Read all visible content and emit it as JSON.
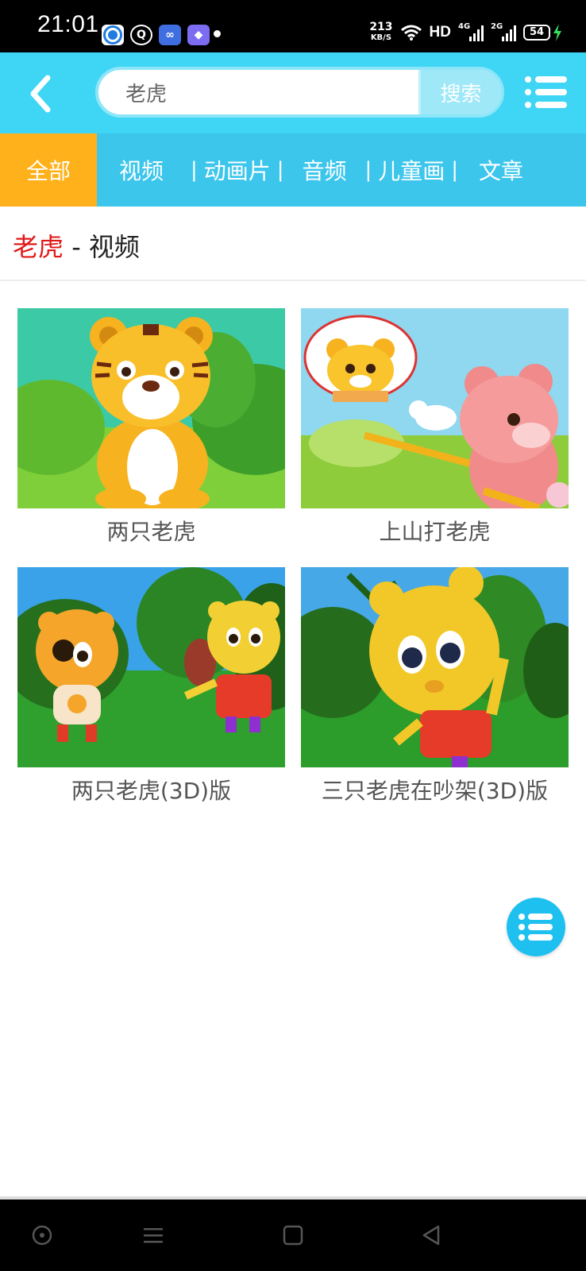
{
  "status_bar": {
    "time": "21:01",
    "net_speed_value": "213",
    "net_speed_unit": "KB/S",
    "hd_label": "HD",
    "signal1_label": "4G",
    "signal2_label": "2G",
    "battery_level": "54"
  },
  "header": {
    "search_value": "老虎",
    "search_button": "搜索"
  },
  "tabs": [
    {
      "label": "全部",
      "active": true
    },
    {
      "label": "视频"
    },
    {
      "label": "动画片"
    },
    {
      "label": "音频"
    },
    {
      "label": "儿童画"
    },
    {
      "label": "文章"
    }
  ],
  "section": {
    "keyword": "老虎",
    "separator": " - ",
    "category": "视频"
  },
  "videos": [
    {
      "title": "两只老虎"
    },
    {
      "title": "上山打老虎"
    },
    {
      "title": "两只老虎(3D)版"
    },
    {
      "title": "三只老虎在吵架(3D)版"
    }
  ],
  "colors": {
    "header_bg": "#3fd5f5",
    "tabs_bg": "#3cc6ec",
    "active_tab": "#ffb11b",
    "keyword": "#e01818",
    "fab": "#1ec0f0"
  },
  "icons": {
    "back": "chevron-left-icon",
    "menu": "menu-icon",
    "fab": "list-icon"
  }
}
